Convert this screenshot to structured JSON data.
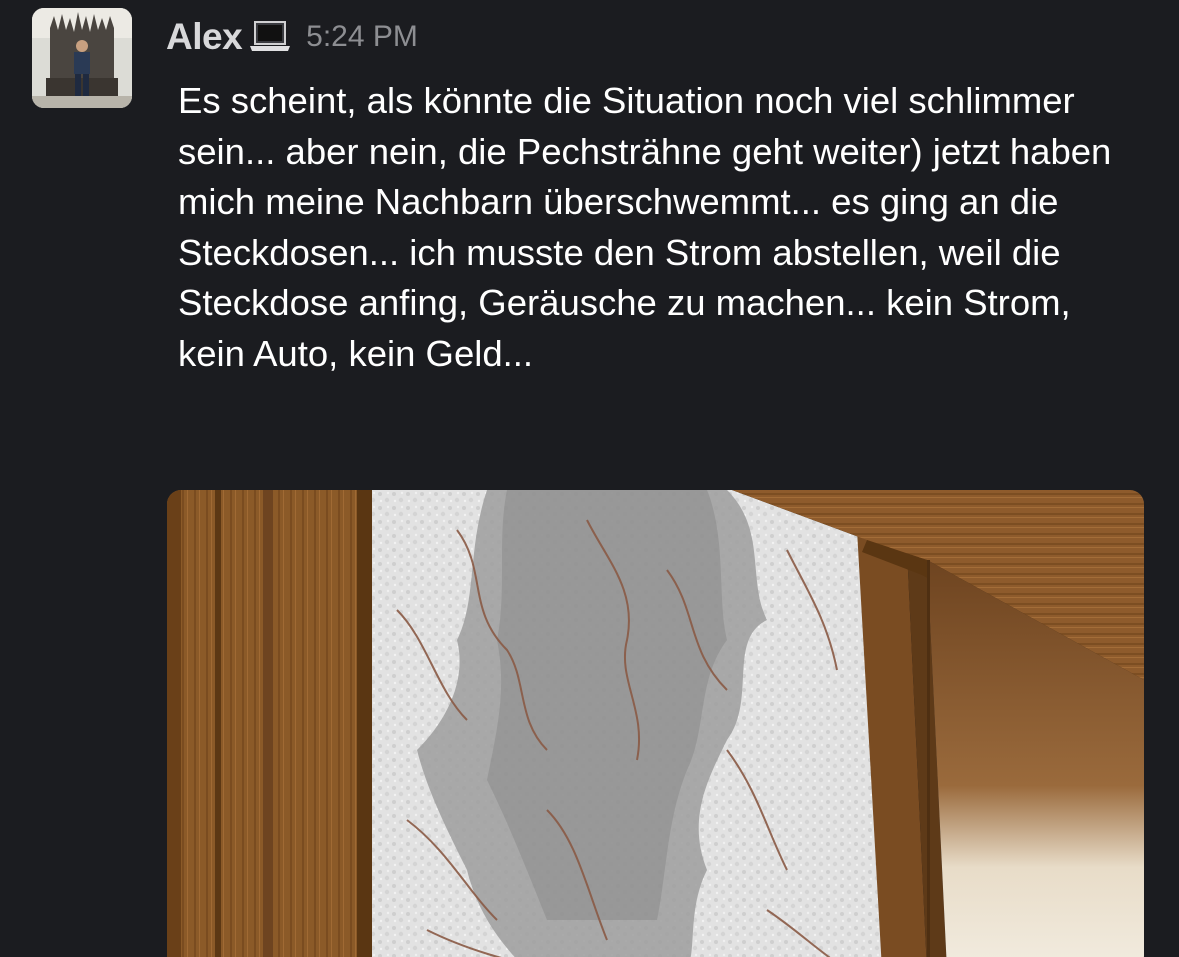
{
  "message": {
    "author": "Alex",
    "timestamp": "5:24 PM",
    "status_icon": "laptop-icon",
    "text": "Es scheint, als könnte die Situation noch viel schlimmer sein... aber nein, die Pechsträhne geht weiter) jetzt haben mich meine Nachbarn überschwemmt... es ging an die Steckdosen... ich musste den Strom abstellen, weil die Steckdose anfing, Geräusche zu machen... kein Strom, kein Auto, kein Geld..."
  },
  "colors": {
    "background": "#1b1c20",
    "username": "#d8d8da",
    "timestamp": "#8d8e92",
    "text": "#ffffff",
    "wood": "#8a5a2a",
    "wallpaper": "#dedede",
    "water_stain": "#9c9c9c"
  }
}
